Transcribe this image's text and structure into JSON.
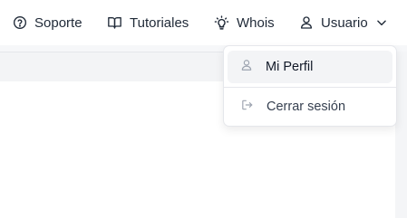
{
  "nav": {
    "items": [
      {
        "label": "Soporte",
        "icon": "help-circle-icon"
      },
      {
        "label": "Tutoriales",
        "icon": "book-open-icon"
      },
      {
        "label": "Whois",
        "icon": "lightbulb-icon"
      },
      {
        "label": "Usuario",
        "icon": "user-icon"
      }
    ]
  },
  "user_menu": {
    "items": [
      {
        "label": "Mi Perfil",
        "icon": "user-icon"
      },
      {
        "label": "Cerrar sesión",
        "icon": "logout-icon"
      }
    ]
  },
  "colors": {
    "text": "#1f2937",
    "icon_muted": "#9ca3af",
    "hover_bg": "#f3f4f6"
  }
}
